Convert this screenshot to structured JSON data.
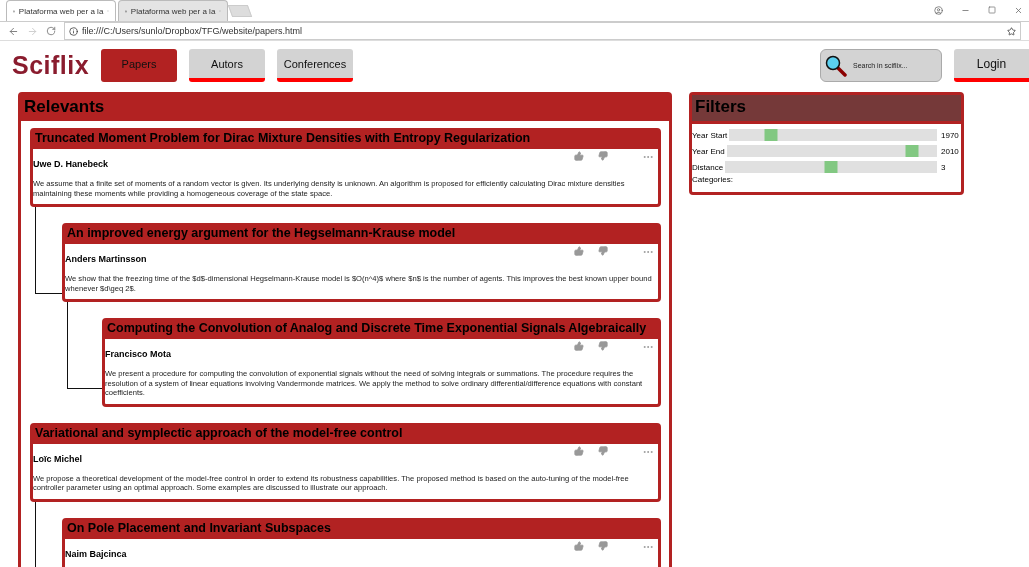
{
  "browser": {
    "tabs": [
      {
        "title": "Plataforma web per a la",
        "selected": true
      },
      {
        "title": "Plataforma web per a la",
        "selected": false
      }
    ],
    "address": "file:///C:/Users/sunlo/Dropbox/TFG/website/papers.html"
  },
  "nav": {
    "logo": "Sciflix",
    "items": [
      {
        "label": "Papers",
        "selected": true
      },
      {
        "label": "Autors",
        "selected": false
      },
      {
        "label": "Conferences",
        "selected": false
      }
    ],
    "search": {
      "placeholder": "Search in sciflix..."
    },
    "login": "Login"
  },
  "relevants": {
    "title": "Relevants",
    "papers": [
      {
        "title": "Truncated Moment Problem for Dirac Mixture Densities with Entropy Regularization",
        "author": "Uwe D. Hanebeck",
        "abstract": "We assume that a finite set of moments of a random vector is given. Its underlying density is unknown. An algorithm is proposed for efficiently calculating Dirac mixture densities maintaining these moments while providing a homogeneous coverage of the state space.",
        "children": [
          {
            "title": "An improved energy argument for the Hegselmann-Krause model",
            "author": "Anders Martinsson",
            "abstract": "We show that the freezing time of the $d$-dimensional Hegselmann-Krause model is $O(n^4)$ where $n$ is the number of agents. This improves the best known upper bound whenever $d\\geq 2$.",
            "children": [
              {
                "title": "Computing the Convolution of Analog and Discrete Time Exponential Signals Algebraically",
                "author": "Francisco Mota",
                "abstract": "We present a procedure for computing the convolution of exponential signals without the need of solving integrals or summations. The procedure requires the resolution of a system of linear equations involving Vandermonde matrices. We apply the method to solve ordinary differential/difference equations with constant coefficients."
              }
            ]
          }
        ]
      },
      {
        "title": "Variational and symplectic approach of the model-free control",
        "author": "Loïc Michel",
        "abstract": "We propose a theoretical development of the model-free control in order to extend its robustness capabilities. The proposed method is based on the auto-tuning of the model-free controller parameter using an optimal approach. Some examples are discussed to illustrate our approach.",
        "children": [
          {
            "title": "On Pole Placement and Invariant Subspaces",
            "author": "Naim Bajcinca"
          }
        ]
      }
    ]
  },
  "filters": {
    "title": "Filters",
    "sliders": [
      {
        "label": "Year Start",
        "level": 0.2,
        "reading": "1970"
      },
      {
        "label": "Year End",
        "level": 0.88,
        "reading": "2010"
      },
      {
        "label": "Distance",
        "level": 0.5,
        "reading": "3"
      }
    ],
    "categories_label": "Categories:"
  }
}
